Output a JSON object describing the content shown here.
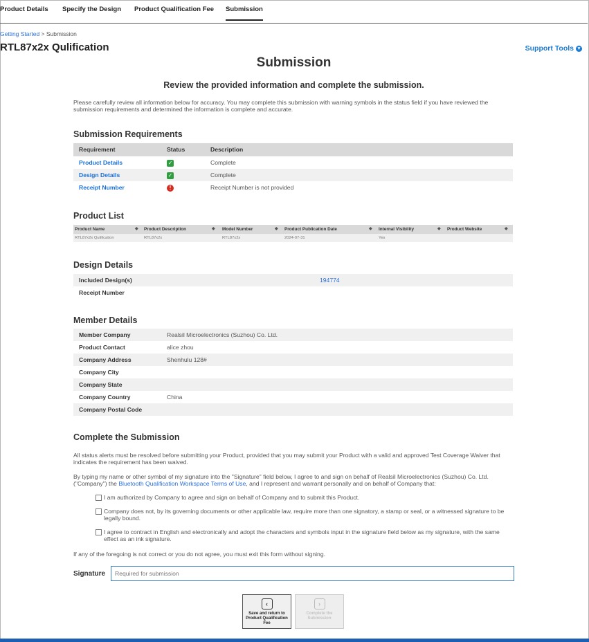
{
  "nav": {
    "tabs": [
      {
        "label": "Product Details"
      },
      {
        "label": "Specify the Design"
      },
      {
        "label": "Product Qualification Fee"
      },
      {
        "label": "Submission"
      }
    ]
  },
  "breadcrumb": {
    "link": "Getting Started",
    "separator": ">",
    "current": "Submission"
  },
  "project_title": "RTL87x2x Qulification",
  "support_tools": "Support Tools",
  "page": {
    "title": "Submission",
    "subtitle": "Review the provided information and complete the submission.",
    "intro": "Please carefully review all information below for accuracy. You may complete this submission with warning symbols in the status field if you have reviewed the submission requirements and determined the information is complete and accurate."
  },
  "requirements": {
    "title": "Submission Requirements",
    "headers": {
      "requirement": "Requirement",
      "status": "Status",
      "description": "Description"
    },
    "rows": [
      {
        "requirement": "Product Details",
        "status": "complete",
        "description": "Complete"
      },
      {
        "requirement": "Design Details",
        "status": "complete",
        "description": "Complete"
      },
      {
        "requirement": "Receipt Number",
        "status": "error",
        "description": "Receipt Number is not provided"
      }
    ]
  },
  "product_list": {
    "title": "Product List",
    "headers": [
      "Product Name",
      "Product Description",
      "Model Number",
      "Product Publication Date",
      "Internal Visibility",
      "Product Website"
    ],
    "rows": [
      [
        "RTL87x2x Qulification",
        "RTL87x2x",
        "RTL87x2x",
        "2024-07-31",
        "Yes",
        ""
      ]
    ]
  },
  "design_details": {
    "title": "Design Details",
    "included_label": "Included Design(s)",
    "included_value": "194774",
    "receipt_label": "Receipt Number",
    "receipt_value": ""
  },
  "member_details": {
    "title": "Member Details",
    "rows": [
      {
        "label": "Member Company",
        "value": "Realsil Microelectronics (Suzhou) Co. Ltd."
      },
      {
        "label": "Product Contact",
        "value": "alice zhou"
      },
      {
        "label": "Company Address",
        "value": "Shenhulu 128#"
      },
      {
        "label": "Company City",
        "value": ""
      },
      {
        "label": "Company State",
        "value": ""
      },
      {
        "label": "Company Country",
        "value": "China"
      },
      {
        "label": "Company Postal Code",
        "value": ""
      }
    ]
  },
  "complete": {
    "title": "Complete the Submission",
    "para1": "All status alerts must be resolved before submitting your Product, provided that you may submit your Product with a valid and approved Test Coverage Waiver that indicates the requirement has been waived.",
    "para2_a": "By typing my name or other symbol of my signature into the \"Signature\" field below, I agree to and sign on behalf of Realsil Microelectronics (Suzhou) Co. Ltd. (\"Company\") the ",
    "para2_link": "Bluetooth Qualification Workspace Terms of Use",
    "para2_b": ", and I represent and warrant personally and on behalf of Company that:",
    "checks": [
      "I am authorized by Company to agree and sign on behalf of Company and to submit this Product.",
      "Company does not, by its governing documents or other applicable law, require more than one signatory, a stamp or seal, or a witnessed signature to be legally bound.",
      "I agree to contract in English and electronically and adopt the characters and symbols input in the signature field below as my signature, with the same effect as an ink signature."
    ],
    "para3": "If any of the foregoing is not correct or you do not agree, you must exit this form without signing.",
    "signature_label": "Signature",
    "signature_placeholder": "Required for submission",
    "save_button": "Save and return to Product Qualification Fee",
    "complete_button": "Complete the Submission"
  },
  "colors": {
    "link": "#1a6fd6",
    "ok": "#2e9e3e",
    "error": "#d72a1e",
    "accent": "#1a5fb4"
  },
  "icons": {
    "ok": "check-square-icon",
    "error": "exclamation-circle-icon",
    "sort": "sort-icon",
    "save": "chevron-left-icon",
    "complete": "chevron-right-icon",
    "support": "chevron-down-circle-icon"
  }
}
